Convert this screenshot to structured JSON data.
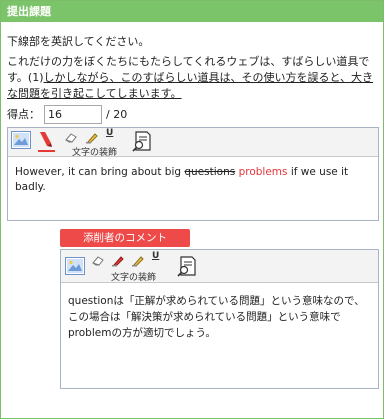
{
  "header": {
    "title": "提出課題"
  },
  "task": {
    "instruction": "下線部を英訳してください。",
    "sentence_plain": "これだけの力をぼくたちにもたらしてくれるウェブは、すばらしい道具です。",
    "sentence_prefix": "(1)",
    "sentence_underlined": "しかしながら、このすばらしい道具は、その使い方を誤ると、大きな問題を引き起こしてしまいます。"
  },
  "score": {
    "label": "得点：",
    "value": "16",
    "total": "/ 20"
  },
  "answer_editor": {
    "toolbar": {
      "image_icon": "image-icon",
      "marker_icon": "red-marker-icon",
      "eraser_icon": "eraser-icon",
      "highlighter_icon": "highlighter-icon",
      "underline_icon": "underline-icon",
      "document_icon": "document-search-icon",
      "caption": "文字の装飾",
      "underline_glyph": "U"
    },
    "text_before": "However, it can bring about big ",
    "text_struck": "questions",
    "text_space": " ",
    "text_correction": "problems",
    "text_after": " if we use it badly."
  },
  "comment": {
    "tag": "添削者のコメント",
    "toolbar": {
      "caption": "文字の装飾",
      "underline_glyph": "U"
    },
    "text": "questionは「正解が求められている問題」という意味なので、この場合は「解決策が求められている問題」という意味でproblemの方が適切でしょう。"
  },
  "colors": {
    "header": "#7cc46a",
    "comment_tag": "#ee4a4a",
    "correction": "#e3363c",
    "editor_border": "#a9b3c6"
  }
}
